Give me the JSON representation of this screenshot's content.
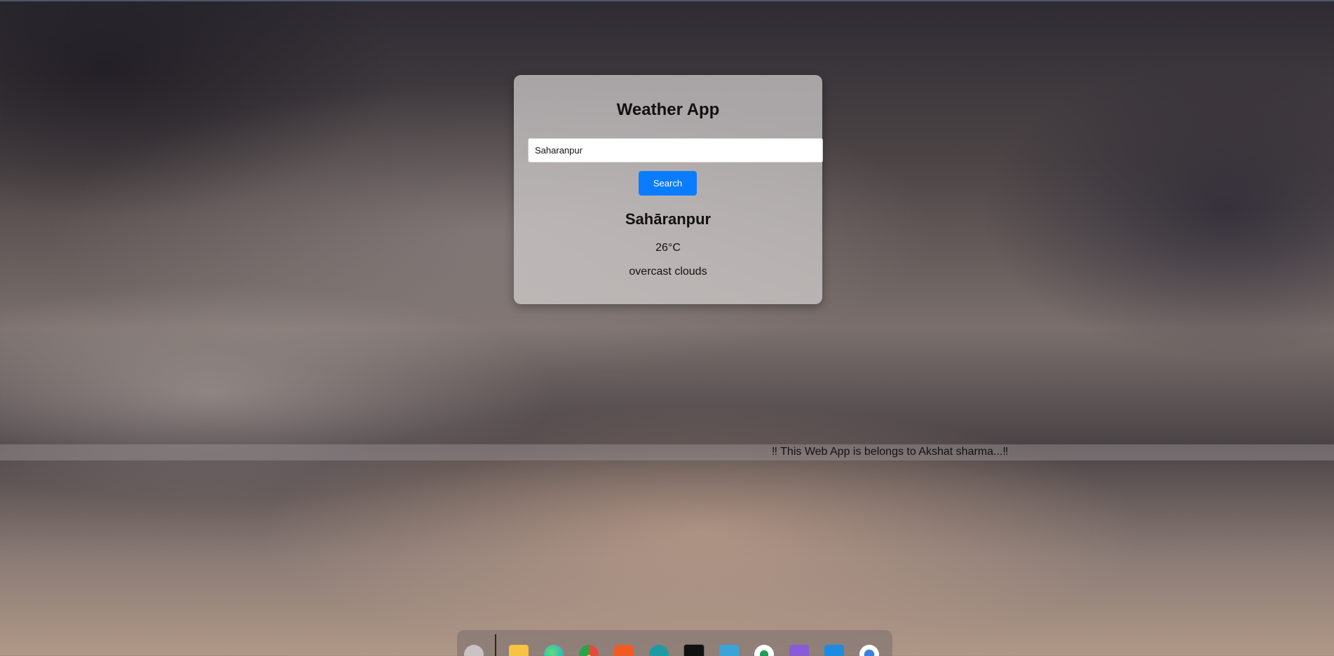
{
  "app": {
    "title": "Weather App"
  },
  "search": {
    "value": "Saharanpur",
    "button_label": "Search"
  },
  "result": {
    "city": "Sahāranpur",
    "temperature": "26°C",
    "description": "overcast clouds"
  },
  "footer": {
    "marquee_text": "‼ This Web App is belongs to Akshat sharma...‼"
  },
  "dock": {
    "items": [
      {
        "name": "apple-icon",
        "color": "#c9c3c3"
      },
      {
        "name": "file-explorer-icon",
        "color": "#f6c343"
      },
      {
        "name": "edge-icon",
        "color": "#1fa0d6"
      },
      {
        "name": "chrome-icon",
        "color": "#e24a3b"
      },
      {
        "name": "brave-icon",
        "color": "#f05a23"
      },
      {
        "name": "arduino-icon",
        "color": "#1e9aa2"
      },
      {
        "name": "terminal-icon",
        "color": "#111111"
      },
      {
        "name": "azure-data-studio-icon",
        "color": "#3aa4d8"
      },
      {
        "name": "mongodb-compass-icon",
        "color": "#1f9e54"
      },
      {
        "name": "visual-studio-icon",
        "color": "#8a5bd6"
      },
      {
        "name": "vscode-icon",
        "color": "#1d8ce0"
      },
      {
        "name": "app-store-icon",
        "color": "#3b7fe0"
      }
    ]
  }
}
